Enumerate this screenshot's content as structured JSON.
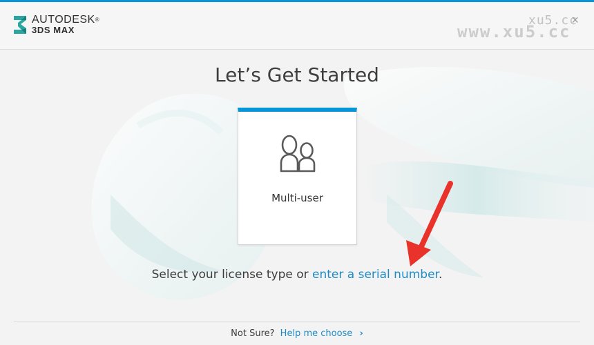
{
  "window": {
    "brand_line1": "AUTODESK",
    "brand_line2": "3DS MAX",
    "trademark_mark": "®",
    "close_label": "×",
    "accent_color": "#0696d7"
  },
  "watermark": {
    "small": "xu5.cc",
    "large": "www.xu5.cc"
  },
  "main": {
    "title": "Let’s Get Started",
    "license_options": [
      {
        "label": "Multi-user",
        "icon": "multi-user-icon"
      }
    ],
    "instruction_prefix": "Select your license type or ",
    "instruction_link": "enter a serial number",
    "instruction_suffix": "."
  },
  "footer": {
    "question": "Not Sure?",
    "help_link": "Help me choose",
    "chevron_icon": "chevron-right-icon"
  },
  "colors": {
    "link": "#1f8bc4",
    "annotation_arrow": "#e8322a"
  }
}
